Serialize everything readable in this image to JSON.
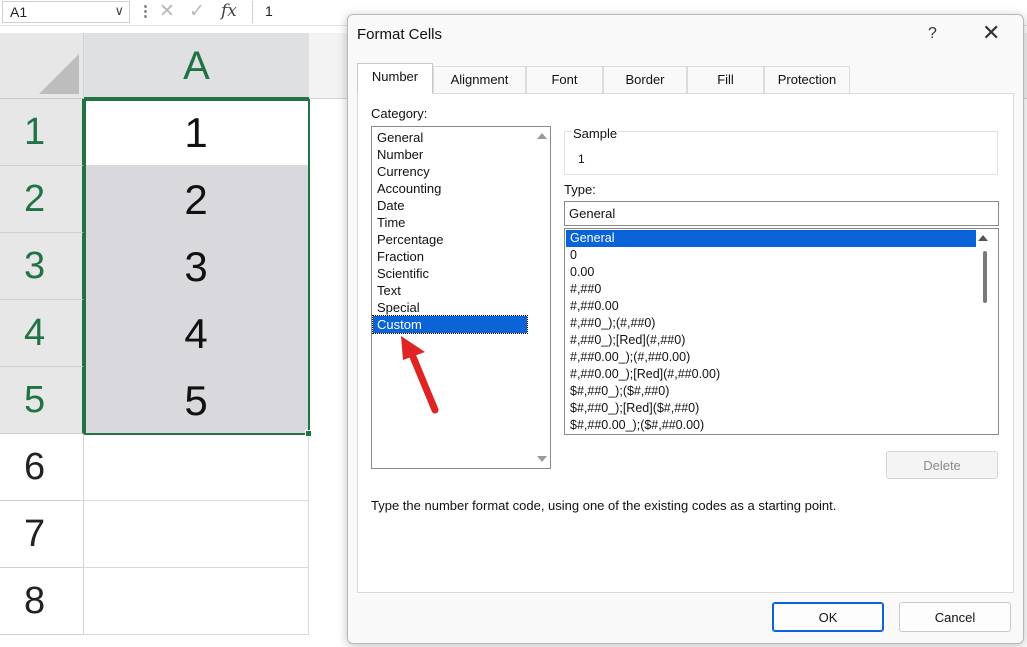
{
  "formula_bar": {
    "name_box": "A1",
    "name_box_dropdown": "∨",
    "separator": "⋮",
    "cancel_glyph": "✕",
    "enter_glyph": "✓",
    "fx": "fx",
    "formula_value": "1"
  },
  "sheet": {
    "column_header": "A",
    "rows": [
      {
        "header": "1",
        "value": "1"
      },
      {
        "header": "2",
        "value": "2"
      },
      {
        "header": "3",
        "value": "3"
      },
      {
        "header": "4",
        "value": "4"
      },
      {
        "header": "5",
        "value": "5"
      },
      {
        "header": "6",
        "value": ""
      },
      {
        "header": "7",
        "value": ""
      },
      {
        "header": "8",
        "value": ""
      }
    ],
    "accent_color": "#217346"
  },
  "dialog": {
    "title": "Format Cells",
    "help": "?",
    "close": "✕",
    "tabs": [
      {
        "label": "Number",
        "active": true
      },
      {
        "label": "Alignment",
        "active": false
      },
      {
        "label": "Font",
        "active": false
      },
      {
        "label": "Border",
        "active": false
      },
      {
        "label": "Fill",
        "active": false
      },
      {
        "label": "Protection",
        "active": false
      }
    ],
    "category_label": "Category:",
    "categories": [
      "General",
      "Number",
      "Currency",
      "Accounting",
      "Date",
      "Time",
      "Percentage",
      "Fraction",
      "Scientific",
      "Text",
      "Special",
      "Custom"
    ],
    "selected_category": "Custom",
    "sample_label": "Sample",
    "sample_value": "1",
    "type_label": "Type:",
    "type_value": "General",
    "type_list": [
      "General",
      "0",
      "0.00",
      "#,##0",
      "#,##0.00",
      "#,##0_);(#,##0)",
      "#,##0_);[Red](#,##0)",
      "#,##0.00_);(#,##0.00)",
      "#,##0.00_);[Red](#,##0.00)",
      "$#,##0_);($#,##0)",
      "$#,##0_);[Red]($#,##0)",
      "$#,##0.00_);($#,##0.00)"
    ],
    "selected_type": "General",
    "delete_label": "Delete",
    "hint": "Type the number format code, using one of the existing codes as a starting point.",
    "ok_label": "OK",
    "cancel_label": "Cancel",
    "selection_color": "#0a64d8",
    "annotation_arrow_color": "#e02424"
  }
}
